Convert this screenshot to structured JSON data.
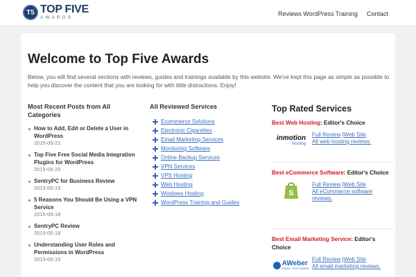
{
  "brand": {
    "badge": "T5",
    "main": "TOP FIVE",
    "sub": "AWARDS"
  },
  "nav": {
    "items": [
      "Reviews",
      "WordPress Training",
      "Contact"
    ]
  },
  "page": {
    "title": "Welcome to Top Five Awards",
    "intro": "Below, you will find several sections with reviews, guides and trainings available by this website. We've kept this page as simple as possible to help you discover the content that you are looking for with little distractions. Enjoy!"
  },
  "recent": {
    "heading": "Most Recent Posts from All Categories",
    "posts": [
      {
        "title": "How to Add, Edit or Delete a User in WordPress",
        "date": "2015-05-21"
      },
      {
        "title": "Top Five Free Social Media Integration Plugins for WordPress",
        "date": "2015-05-20"
      },
      {
        "title": "SentryPC for Business Review",
        "date": "2015-05-19"
      },
      {
        "title": "5 Reasons You Should Be Using a VPN Service",
        "date": "2015-05-18"
      },
      {
        "title": "SentryPC Review",
        "date": "2015-05-18"
      },
      {
        "title": "Understanding User Roles and Permissions in WordPress",
        "date": "2015-05-15"
      }
    ]
  },
  "services": {
    "heading": "All Reviewed Services",
    "items": [
      "Ecommerce Solutions",
      "Electronic Cigarettes",
      "Email Marketing Services",
      "Monitoring Software",
      "Online Backup Services",
      "VPN Services",
      "VPS Hosting",
      "Web Hosting",
      "Windows Hosting",
      "WordPress Training and Guides"
    ]
  },
  "top_rated": {
    "heading": "Top Rated Services",
    "sections": [
      {
        "category": "Best Web Hosting",
        "suffix": ": Editor's Choice",
        "logo_text": "inmotion",
        "logo_sub": "hosting",
        "full_review": "Full Review",
        "sep": "|",
        "web_site": "Web Site",
        "all_link": "All web hosting reviews."
      },
      {
        "category": "Best eCommerce Software",
        "suffix": ": Editor's Choice",
        "logo_text": "",
        "logo_sub": "",
        "full_review": "Full Review",
        "sep": "|",
        "web_site": "Web Site",
        "all_link": "All eCommerce software reviews."
      },
      {
        "category": "Best Email Marketing Service",
        "suffix": ": Editor's Choice",
        "logo_text": "AWeber",
        "logo_sub": "EMAIL SOFTWARE",
        "full_review": "Full Review",
        "sep": "|",
        "web_site": "Web Site",
        "all_link": "All email marketing reviews."
      }
    ]
  },
  "colors": {
    "accent_red": "#d2191e",
    "link_blue": "#3b6fc1",
    "brand_navy": "#1c3a6b",
    "shopify_green": "#95bf47"
  }
}
